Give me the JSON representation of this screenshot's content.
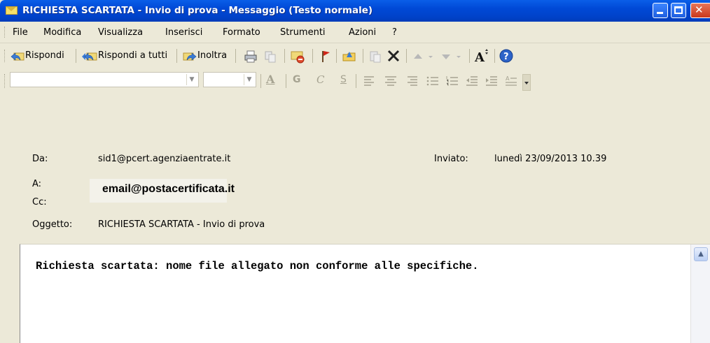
{
  "window": {
    "title": "RICHIESTA SCARTATA - Invio di prova - Messaggio (Testo normale)"
  },
  "menu": [
    "File",
    "Modifica",
    "Visualizza",
    "Inserisci",
    "Formato",
    "Strumenti",
    "Azioni",
    "?"
  ],
  "toolbar": {
    "reply": "Rispondi",
    "reply_all": "Rispondi a tutti",
    "forward": "Inoltra"
  },
  "format_toolbar": {
    "bold_glyph": "G",
    "italic_glyph": "C",
    "underline_glyph": "S",
    "font_color_glyph": "A"
  },
  "header": {
    "from_label": "Da:",
    "from_value": "sid1@pcert.agenziaentrate.it",
    "sent_label": "Inviato:",
    "sent_value": "lunedì 23/09/2013 10.39",
    "to_label": "A:",
    "to_value": "email@postacertificata.it",
    "cc_label": "Cc:",
    "subject_label": "Oggetto:",
    "subject_value": "RICHIESTA SCARTATA - Invio di prova"
  },
  "message": {
    "body": "Richiesta scartata: nome file allegato non conforme alle specifiche."
  },
  "colors": {
    "titlebar": "#0049d6",
    "chrome": "#ece9d8"
  }
}
